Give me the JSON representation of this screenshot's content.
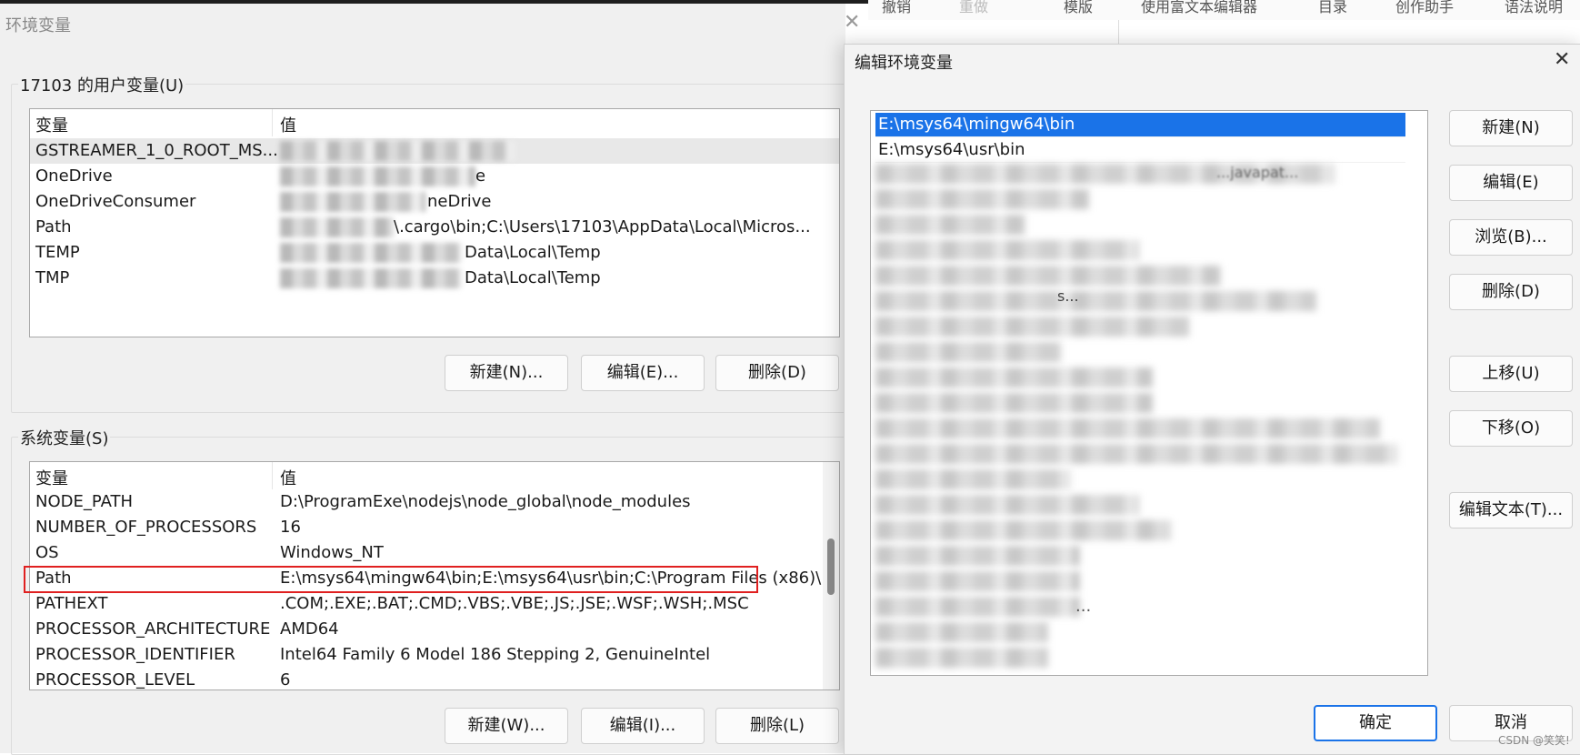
{
  "background_editor": {
    "toolbar": [
      "撤销",
      "重做",
      "模版",
      "使用富文本编辑器",
      "目录",
      "创作助手",
      "语法说明"
    ]
  },
  "env_window": {
    "title": "环境变量",
    "user_group": {
      "label": "17103 的用户变量(U)",
      "col_name": "变量",
      "col_value": "值",
      "rows": [
        {
          "name": "GSTREAMER_1_0_ROOT_MS...",
          "value": ""
        },
        {
          "name": "OneDrive",
          "value": "e"
        },
        {
          "name": "OneDriveConsumer",
          "value": "neDrive"
        },
        {
          "name": "Path",
          "value": "\\.cargo\\bin;C:\\Users\\17103\\AppData\\Local\\Micros..."
        },
        {
          "name": "TEMP",
          "value": "Data\\Local\\Temp"
        },
        {
          "name": "TMP",
          "value": "Data\\Local\\Temp"
        }
      ],
      "buttons": {
        "new": "新建(N)...",
        "edit": "编辑(E)...",
        "delete": "删除(D)"
      }
    },
    "system_group": {
      "label": "系统变量(S)",
      "col_name": "变量",
      "col_value": "值",
      "rows": [
        {
          "name": "NODE_PATH",
          "value": "D:\\ProgramExe\\nodejs\\node_global\\node_modules"
        },
        {
          "name": "NUMBER_OF_PROCESSORS",
          "value": "16"
        },
        {
          "name": "OS",
          "value": "Windows_NT"
        },
        {
          "name": "Path",
          "value": "E:\\msys64\\mingw64\\bin;E:\\msys64\\usr\\bin;C:\\Program Files (x86)\\..."
        },
        {
          "name": "PATHEXT",
          "value": ".COM;.EXE;.BAT;.CMD;.VBS;.VBE;.JS;.JSE;.WSF;.WSH;.MSC"
        },
        {
          "name": "PROCESSOR_ARCHITECTURE",
          "value": "AMD64"
        },
        {
          "name": "PROCESSOR_IDENTIFIER",
          "value": "Intel64 Family 6 Model 186 Stepping 2, GenuineIntel"
        },
        {
          "name": "PROCESSOR_LEVEL",
          "value": "6"
        }
      ],
      "buttons": {
        "new": "新建(W)...",
        "edit": "编辑(I)...",
        "delete": "删除(L)"
      }
    }
  },
  "edit_dialog": {
    "title": "编辑环境变量",
    "entries": [
      "E:\\msys64\\mingw64\\bin",
      "E:\\msys64\\usr\\bin",
      "...javapat...",
      "...",
      "s..."
    ],
    "buttons": {
      "new": "新建(N)",
      "edit": "编辑(E)",
      "browse": "浏览(B)...",
      "delete": "删除(D)",
      "move_up": "上移(U)",
      "move_down": "下移(O)",
      "edit_text": "编辑文本(T)...",
      "ok": "确定",
      "cancel": "取消"
    }
  },
  "watermark": "CSDN @笑笑!",
  "colors": {
    "selection": "#1a73e8",
    "highlight_box": "#e02020"
  }
}
